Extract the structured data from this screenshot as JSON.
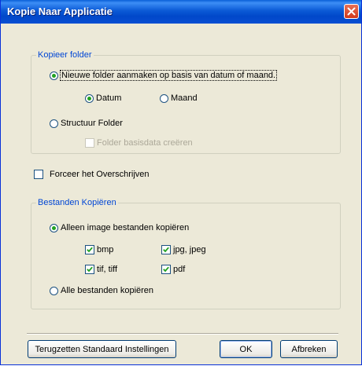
{
  "window": {
    "title": "Kopie Naar Applicatie"
  },
  "copy_folder": {
    "legend": "Kopieer folder",
    "new_folder_label": "Nieuwe folder aanmaken op basis van datum of maand.",
    "new_folder_selected": true,
    "date_label": "Datum",
    "date_selected": true,
    "month_label": "Maand",
    "month_selected": false,
    "structure_label": "Structuur Folder",
    "structure_selected": false,
    "basedata_label": "Folder basisdata creëren",
    "basedata_checked": false,
    "basedata_enabled": false
  },
  "overwrite": {
    "label": "Forceer het Overschrijven",
    "checked": false
  },
  "copy_files": {
    "legend": "Bestanden Kopiëren",
    "image_only_label": "Alleen image bestanden kopiëren",
    "image_only_selected": true,
    "types": [
      {
        "label": "bmp",
        "checked": true
      },
      {
        "label": "jpg, jpeg",
        "checked": true
      },
      {
        "label": "tif, tiff",
        "checked": true
      },
      {
        "label": "pdf",
        "checked": true
      }
    ],
    "all_files_label": "Alle bestanden kopiëren",
    "all_files_selected": false
  },
  "buttons": {
    "reset_label": "Terugzetten Standaard Instellingen",
    "ok_label": "OK",
    "cancel_label": "Afbreken"
  },
  "colors": {
    "title_bar": "#0a5fd8",
    "legend_text": "#0046d5",
    "dialog_bg": "#ece9d8",
    "radio_dot": "#21a121"
  }
}
